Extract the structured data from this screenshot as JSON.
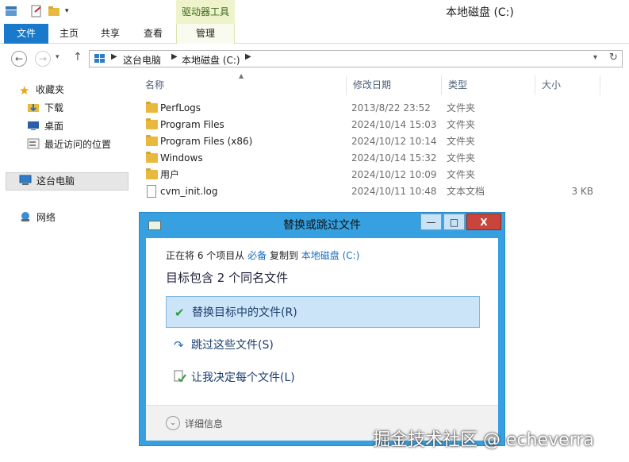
{
  "window": {
    "title": "本地磁盘 (C:)",
    "context_tab_group": "驱动器工具"
  },
  "ribbon": {
    "tabs": [
      "文件",
      "主页",
      "共享",
      "查看",
      "管理"
    ]
  },
  "address": {
    "crumbs": [
      "这台电脑",
      "本地磁盘 (C:)"
    ]
  },
  "nav_pane": {
    "favorites": "收藏夹",
    "favorites_items": [
      "下载",
      "桌面",
      "最近访问的位置"
    ],
    "this_pc": "这台电脑",
    "network": "网络"
  },
  "file_list": {
    "columns": [
      "名称",
      "修改日期",
      "类型",
      "大小"
    ],
    "rows": [
      {
        "name": "PerfLogs",
        "date": "2013/8/22 23:52",
        "type": "文件夹",
        "size": "",
        "icon": "folder"
      },
      {
        "name": "Program Files",
        "date": "2024/10/14 15:03",
        "type": "文件夹",
        "size": "",
        "icon": "folder"
      },
      {
        "name": "Program Files (x86)",
        "date": "2024/10/12 10:14",
        "type": "文件夹",
        "size": "",
        "icon": "folder"
      },
      {
        "name": "Windows",
        "date": "2024/10/14 15:32",
        "type": "文件夹",
        "size": "",
        "icon": "folder"
      },
      {
        "name": "用户",
        "date": "2024/10/12 10:09",
        "type": "文件夹",
        "size": "",
        "icon": "folder"
      },
      {
        "name": "cvm_init.log",
        "date": "2024/10/11 10:48",
        "type": "文本文档",
        "size": "3 KB",
        "icon": "document"
      }
    ]
  },
  "dialog": {
    "title": "替换或跳过文件",
    "status_prefix": "正在将 6 个项目从",
    "status_source": "必备",
    "status_middle": "复制到",
    "status_dest": "本地磁盘 (C:)",
    "heading": "目标包含 2 个同名文件",
    "options": [
      {
        "label": "替换目标中的文件(R)",
        "icon": "check-icon"
      },
      {
        "label": "跳过这些文件(S)",
        "icon": "skip-arrow-icon"
      },
      {
        "label": "让我决定每个文件(L)",
        "icon": "decide-files-icon"
      }
    ],
    "details": "详细信息",
    "buttons": {
      "minimize": "—",
      "maximize": "□",
      "close": "X"
    }
  },
  "watermark": "掘金技术社区 @ echeverra",
  "colors": {
    "accent": "#1979ca",
    "dialog_frame": "#37a0e0",
    "close": "#c9453c",
    "selected_option": "#cce4f7",
    "folder": "#e9b93f"
  }
}
